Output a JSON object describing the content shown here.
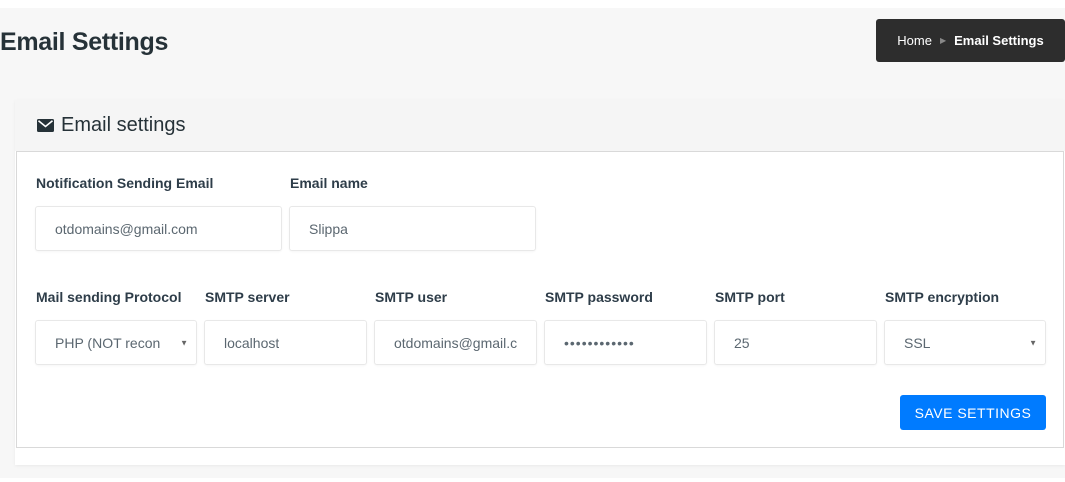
{
  "page": {
    "title": "Email Settings"
  },
  "breadcrumb": {
    "home": "Home",
    "separator": "›",
    "current": "Email Settings"
  },
  "card": {
    "icon": "envelope-icon",
    "title": "Email settings"
  },
  "fields": {
    "notification_email": {
      "label": "Notification Sending Email",
      "value": "otdomains@gmail.com"
    },
    "email_name": {
      "label": "Email name",
      "value": "Slippa"
    },
    "protocol": {
      "label": "Mail sending Protocol",
      "value": "PHP (NOT recon"
    },
    "smtp_server": {
      "label": "SMTP server",
      "value": "localhost"
    },
    "smtp_user": {
      "label": "SMTP user",
      "value": "otdomains@gmail.c"
    },
    "smtp_password": {
      "label": "SMTP password",
      "value": "••••••••••••"
    },
    "smtp_port": {
      "label": "SMTP port",
      "value": "25"
    },
    "smtp_encryption": {
      "label": "SMTP encryption",
      "value": "SSL"
    }
  },
  "actions": {
    "save_label": "SAVE SETTINGS"
  },
  "colors": {
    "accent": "#007bff",
    "breadcrumb_bg": "#2d2d2d",
    "header_bg": "#f5f5f5"
  }
}
